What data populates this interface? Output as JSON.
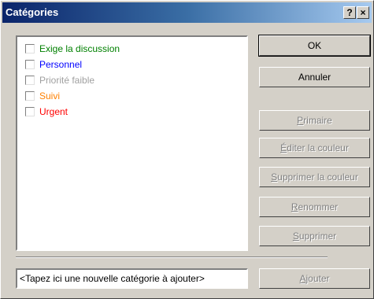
{
  "window": {
    "title": "Catégories",
    "help_label": "?",
    "close_label": "×"
  },
  "categories": [
    {
      "label": "Exige la discussion",
      "color": "#008000",
      "checked": false
    },
    {
      "label": "Personnel",
      "color": "#0000ff",
      "checked": false
    },
    {
      "label": "Priorité faible",
      "color": "#a0a0a0",
      "checked": false
    },
    {
      "label": "Suivi",
      "color": "#ff8000",
      "checked": false
    },
    {
      "label": "Urgent",
      "color": "#ff0000",
      "checked": false
    }
  ],
  "buttons": {
    "ok": "OK",
    "cancel": "Annuler",
    "primary": "Primaire",
    "edit_color": "Éditer la couleur",
    "remove_color": "Supprimer la couleur",
    "rename": "Renommer",
    "delete": "Supprimer",
    "add": "Ajouter"
  },
  "new_category": {
    "value": "<Tapez ici une nouvelle catégorie à ajouter>"
  }
}
